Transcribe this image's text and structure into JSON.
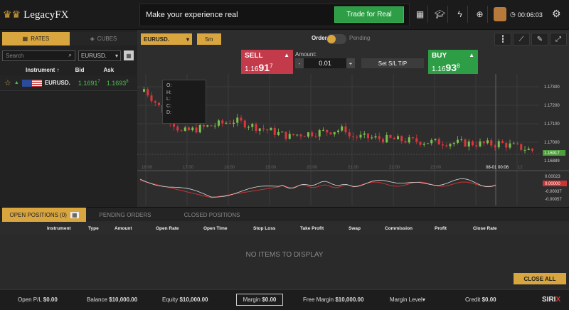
{
  "brand": {
    "logo_text": "LegacyFX"
  },
  "header": {
    "message": "Make your experience real",
    "cta_label": "Trade for Real",
    "timer": "00:06:03"
  },
  "left_panel": {
    "tabs": {
      "rates": "RATES",
      "cubes": "CUBES"
    },
    "search_placeholder": "Search",
    "filter_value": "EURUSD.",
    "columns": {
      "instrument": "Instrument",
      "bid": "Bid",
      "ask": "Ask"
    },
    "rows": [
      {
        "symbol": "EURUSD.",
        "bid_main": "1.1691",
        "bid_sup": "7",
        "ask_main": "1.1693",
        "ask_sup": "8"
      }
    ]
  },
  "chart_toolbar": {
    "pair": "EURUSD.",
    "timeframe": "5m",
    "order_label": "Order",
    "pending_label": "Pending"
  },
  "trade_panel": {
    "sell_label": "SELL",
    "sell_price_main": "1.16",
    "sell_price_big": "91",
    "sell_price_sup": "7",
    "buy_label": "BUY",
    "buy_price_main": "1.16",
    "buy_price_big": "93",
    "buy_price_sup": "8",
    "amount_label": "Amount:",
    "amount_value": "0.01",
    "minus": "-",
    "plus": "+",
    "sltp_label": "Set S/L T/P"
  },
  "ohlc": {
    "o": "O:",
    "h": "H:",
    "l": "L:",
    "c": "C:",
    "d": "D:"
  },
  "price_axis": [
    "1.17300",
    "1.17200",
    "1.17100",
    "1.17000",
    "1.16917",
    "1.16889"
  ],
  "time_axis": [
    "16:00",
    "17:00",
    "18:00",
    "19:00",
    "20:00",
    "21:00",
    "22:00",
    "23:00",
    "08-01 00:06",
    "12"
  ],
  "indicator_axis": [
    "0.00023",
    "0.00000",
    "-0.00037",
    "-0.00057"
  ],
  "positions": {
    "tabs": {
      "open": "OPEN POSITIONS (0)",
      "pending": "PENDING ORDERS",
      "closed": "CLOSED POSITIONS"
    },
    "columns": [
      "Instrument",
      "Type",
      "Amount",
      "Open Rate",
      "Open Time",
      "Stop Loss",
      "Take Profit",
      "Swap",
      "Commission",
      "Profit",
      "Close Rate"
    ],
    "empty_text": "NO ITEMS TO DISPLAY",
    "close_all": "CLOSE ALL"
  },
  "footer": {
    "open_pl_label": "Open P/L",
    "open_pl": "$0.00",
    "balance_label": "Balance",
    "balance": "$10,000.00",
    "equity_label": "Equity",
    "equity": "$10,000.00",
    "margin_label": "Margin",
    "margin": "$0.00",
    "free_margin_label": "Free Margin",
    "free_margin": "$10,000.00",
    "margin_level_label": "Margin Level",
    "credit_label": "Credit",
    "credit": "$0.00",
    "brand": "SIRIX"
  },
  "colors": {
    "accent": "#d8a53f",
    "sell": "#c33a4a",
    "buy": "#2e9e46",
    "bull_candle": "#7dbf4f",
    "bear_candle": "#d9363e"
  }
}
